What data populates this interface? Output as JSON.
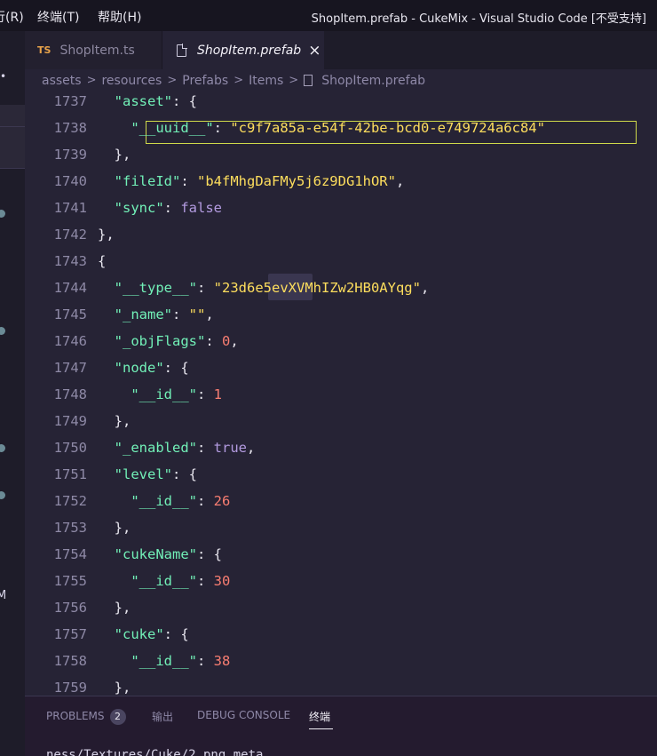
{
  "menu": {
    "run": "行(R)",
    "terminal": "终端(T)",
    "help": "帮助(H)"
  },
  "window_title": "ShopItem.prefab - CukeMix - Visual Studio Code [不受支持]",
  "tabs": [
    {
      "icon": "TS",
      "label": "ShopItem.ts",
      "active": false
    },
    {
      "icon": "file-icon",
      "label": "ShopItem.prefab",
      "active": true,
      "close": "×"
    }
  ],
  "breadcrumb": [
    "assets",
    "resources",
    "Prefabs",
    "Items",
    "ShopItem.prefab"
  ],
  "editor": {
    "lines": [
      {
        "num": "1737",
        "indent": "  ",
        "tokens": [
          [
            "k",
            "\"asset\""
          ],
          [
            "p",
            ": {"
          ]
        ]
      },
      {
        "num": "1738",
        "indent": "    ",
        "tokens": [
          [
            "k",
            "\"__uuid__\""
          ],
          [
            "p",
            ": "
          ],
          [
            "s",
            "\"c9f7a85a-e54f-42be-bcd0-e749724a6c84\""
          ]
        ]
      },
      {
        "num": "1739",
        "indent": "  ",
        "tokens": [
          [
            "p",
            "},"
          ]
        ]
      },
      {
        "num": "1740",
        "indent": "  ",
        "tokens": [
          [
            "k",
            "\"fileId\""
          ],
          [
            "p",
            ": "
          ],
          [
            "s",
            "\"b4fMhgDaFMy5j6z9DG1hOR\""
          ],
          [
            "p",
            ","
          ]
        ]
      },
      {
        "num": "1741",
        "indent": "  ",
        "tokens": [
          [
            "k",
            "\"sync\""
          ],
          [
            "p",
            ": "
          ],
          [
            "b",
            "false"
          ]
        ]
      },
      {
        "num": "1742",
        "indent": "",
        "tokens": [
          [
            "p",
            "},"
          ]
        ]
      },
      {
        "num": "1743",
        "indent": "",
        "tokens": [
          [
            "p",
            "{"
          ]
        ]
      },
      {
        "num": "1744",
        "indent": "  ",
        "tokens": [
          [
            "k",
            "\"__type__\""
          ],
          [
            "p",
            ": "
          ],
          [
            "s",
            "\"23d6e5evXVMhIZw2HB0AYqg\""
          ],
          [
            "p",
            ","
          ]
        ]
      },
      {
        "num": "1745",
        "indent": "  ",
        "tokens": [
          [
            "k",
            "\"_name\""
          ],
          [
            "p",
            ": "
          ],
          [
            "s",
            "\"\""
          ],
          [
            "p",
            ","
          ]
        ]
      },
      {
        "num": "1746",
        "indent": "  ",
        "tokens": [
          [
            "k",
            "\"_objFlags\""
          ],
          [
            "p",
            ": "
          ],
          [
            "n",
            "0"
          ],
          [
            "p",
            ","
          ]
        ]
      },
      {
        "num": "1747",
        "indent": "  ",
        "tokens": [
          [
            "k",
            "\"node\""
          ],
          [
            "p",
            ": {"
          ]
        ]
      },
      {
        "num": "1748",
        "indent": "    ",
        "tokens": [
          [
            "k",
            "\"__id__\""
          ],
          [
            "p",
            ": "
          ],
          [
            "n",
            "1"
          ]
        ]
      },
      {
        "num": "1749",
        "indent": "  ",
        "tokens": [
          [
            "p",
            "},"
          ]
        ]
      },
      {
        "num": "1750",
        "indent": "  ",
        "tokens": [
          [
            "k",
            "\"_enabled\""
          ],
          [
            "p",
            ": "
          ],
          [
            "b",
            "true"
          ],
          [
            "p",
            ","
          ]
        ]
      },
      {
        "num": "1751",
        "indent": "  ",
        "tokens": [
          [
            "k",
            "\"level\""
          ],
          [
            "p",
            ": {"
          ]
        ]
      },
      {
        "num": "1752",
        "indent": "    ",
        "tokens": [
          [
            "k",
            "\"__id__\""
          ],
          [
            "p",
            ": "
          ],
          [
            "n",
            "26"
          ]
        ]
      },
      {
        "num": "1753",
        "indent": "  ",
        "tokens": [
          [
            "p",
            "},"
          ]
        ]
      },
      {
        "num": "1754",
        "indent": "  ",
        "tokens": [
          [
            "k",
            "\"cukeName\""
          ],
          [
            "p",
            ": {"
          ]
        ]
      },
      {
        "num": "1755",
        "indent": "    ",
        "tokens": [
          [
            "k",
            "\"__id__\""
          ],
          [
            "p",
            ": "
          ],
          [
            "n",
            "30"
          ]
        ]
      },
      {
        "num": "1756",
        "indent": "  ",
        "tokens": [
          [
            "p",
            "},"
          ]
        ]
      },
      {
        "num": "1757",
        "indent": "  ",
        "tokens": [
          [
            "k",
            "\"cuke\""
          ],
          [
            "p",
            ": {"
          ]
        ]
      },
      {
        "num": "1758",
        "indent": "    ",
        "tokens": [
          [
            "k",
            "\"__id__\""
          ],
          [
            "p",
            ": "
          ],
          [
            "n",
            "38"
          ]
        ]
      },
      {
        "num": "1759",
        "indent": "  ",
        "tokens": [
          [
            "p",
            "},"
          ]
        ]
      }
    ]
  },
  "panel": {
    "problems_label": "PROBLEMS",
    "problems_count": "2",
    "output_label": "输出",
    "debug_label": "DEBUG CONSOLE",
    "terminal_label": "终端",
    "terminal_text": "ness/Textures/Cuke/2.png.meta"
  },
  "side": {
    "chevron": "•",
    "letter": "M"
  },
  "colors": {
    "background": "#262335",
    "key": "#72f1b8",
    "string": "#fede5d",
    "number": "#f97e72",
    "boolean": "#b39be0",
    "line_highlight": "#cfd94a"
  }
}
